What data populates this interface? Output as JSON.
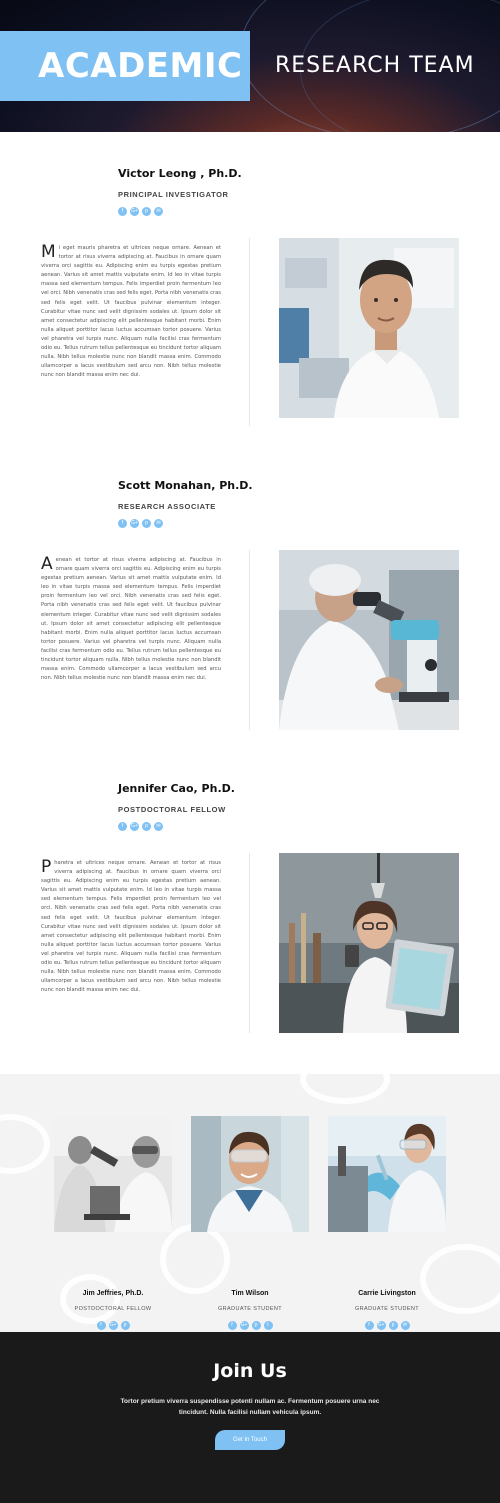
{
  "hero": {
    "title": "ACADEMIC",
    "subtitle": "RESEARCH TEAM"
  },
  "members": [
    {
      "name": "Victor Leong , Ph.D.",
      "role": "PRINCIPAL INVESTIGATOR",
      "drop": "M",
      "bio": "i eget mauris pharetra et ultrices neque ornare. Aenean et tortor at risus viverra adipiscing at. Faucibus in ornare quam viverra orci sagittis eu. Adipiscing enim eu turpis egestas pretium aenean. Varius sit amet mattis vulputate enim. Id leo in vitae turpis massa sed elementum tempus. Felis imperdiet proin fermentum leo vel orci. Nibh venenatis cras sed felis eget. Porta nibh venenatis cras sed felis eget velit. Ut faucibus pulvinar elementum integer. Curabitur vitae nunc sed velit dignissim sodales ut. Ipsum dolor sit amet consectetur adipiscing elit pellentesque habitant morbi. Enim nulla aliquet porttitor lacus luctus accumsan tortor posuere. Varius vel pharetra vel turpis nunc. Aliquam nulla facilisi cras fermentum odio eu. Tellus rutrum tellus pellentesque eu tincidunt tortor aliquam nulla. Nibh tellus molestie nunc non blandit massa enim. Commodo ullamcorper a lacus vestibulum sed arcu non. Nibh tellus molestie nunc non blandit massa enim nec dui."
    },
    {
      "name": "Scott Monahan, Ph.D.",
      "role": "RESEARCH ASSOCIATE",
      "drop": "A",
      "bio": "enean et tortor at risus viverra adipiscing at. Faucibus in ornare quam viverra orci sagittis eu. Adipiscing enim eu turpis egestas pretium aenean. Varius sit amet mattis vulputate enim. Id leo in vitae turpis massa sed elementum tempus. Felis imperdiet proin fermentum leo vel orci. Nibh venenatis cras sed felis eget. Porta nibh venenatis cras sed felis eget velit. Ut faucibus pulvinar elementum integer. Curabitur vitae nunc sed velit dignissim sodales ut. Ipsum dolor sit amet consectetur adipiscing elit pellentesque habitant morbi. Enim nulla aliquet porttitor lacus luctus accumsan tortor posuere. Varius vel pharetra vel turpis nunc. Aliquam nulla facilisi cras fermentum odio eu. Tellus rutrum tellus pellentesque eu tincidunt tortor aliquam nulla. Nibh tellus molestie nunc non blandit massa enim. Commodo ullamcorper a lacus vestibulum sed arcu non. Nibh tellus molestie nunc non blandit massa enim nec dui."
    },
    {
      "name": "Jennifer Cao, Ph.D.",
      "role": "POSTDOCTORAL FELLOW",
      "drop": "P",
      "bio": "haretra et ultrices neque ornare. Aenean et tortor at risus viverra adipiscing at. Faucibus in ornare quam viverra orci sagittis eu. Adipiscing enim eu turpis egestas pretium aenean. Varius sit amet mattis vulputate enim. Id leo in vitae turpis massa sed elementum tempus. Felis imperdiet proin fermentum leo vel orci. Nibh venenatis cras sed felis eget. Porta nibh venenatis cras sed felis eget velit. Ut faucibus pulvinar elementum integer. Curabitur vitae nunc sed velit dignissim sodales ut. Ipsum dolor sit amet consectetur adipiscing elit pellentesque habitant morbi. Enim nulla aliquet porttitor lacus luctus accumsan tortor posuere. Varius vel pharetra vel turpis nunc. Aliquam nulla facilisi cras fermentum odio eu. Tellus rutrum tellus pellentesque eu tincidunt tortor aliquam nulla. Nibh tellus molestie nunc non blandit massa enim. Commodo ullamcorper a lacus vestibulum sed arcu non. Nibh tellus molestie nunc non blandit massa enim nec dui."
    }
  ],
  "team": [
    {
      "name": "Jim Jeffries, Ph.D.",
      "role": "POSTDOCTORAL FELLOW"
    },
    {
      "name": "Tim Wilson",
      "role": "GRADUATE STUDENT"
    },
    {
      "name": "Carrie Livingston",
      "role": "GRADUATE STUDENT"
    }
  ],
  "social_icons": [
    "facebook-icon",
    "google-plus-icon",
    "pinterest-icon",
    "email-icon"
  ],
  "social_glyphs": [
    "f",
    "G+",
    "p",
    "✉"
  ],
  "team_social_glyphs": [
    "f",
    "G+",
    "p",
    "t"
  ],
  "footer": {
    "heading": "Join Us",
    "text": "Tortor pretium viverra suspendisse potenti nullam ac. Fermentum posuere urna nec tincidunt. Nulla facilisi nullam vehicula ipsum.",
    "button": "Get In Touch"
  },
  "colors": {
    "accent": "#7fc1f2",
    "footer_bg": "#1a1a1a",
    "team_bg": "#f3f3f3"
  }
}
